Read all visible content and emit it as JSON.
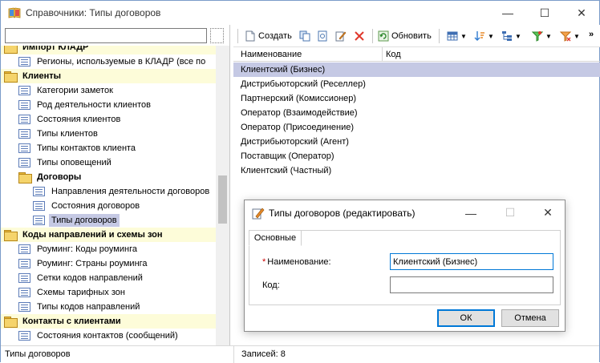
{
  "window": {
    "title": "Справочники: Типы договоров",
    "minimize": "—",
    "maximize": "☐",
    "close": "✕"
  },
  "search": {
    "value": "",
    "placeholder": ""
  },
  "tree": [
    {
      "label": "Импорт КЛАДР",
      "type": "group",
      "indent": 0
    },
    {
      "label": "Регионы, используемые в КЛАДР (все по",
      "type": "item",
      "indent": 1
    },
    {
      "label": "Клиенты",
      "type": "group",
      "indent": 0
    },
    {
      "label": "Категории заметок",
      "type": "item",
      "indent": 1
    },
    {
      "label": "Род деятельности клиентов",
      "type": "item",
      "indent": 1
    },
    {
      "label": "Состояния клиентов",
      "type": "item",
      "indent": 1
    },
    {
      "label": "Типы клиентов",
      "type": "item",
      "indent": 1
    },
    {
      "label": "Типы контактов клиента",
      "type": "item",
      "indent": 1
    },
    {
      "label": "Типы оповещений",
      "type": "item",
      "indent": 1
    },
    {
      "label": "Договоры",
      "type": "subgroup",
      "indent": 1
    },
    {
      "label": "Направления деятельности договоров",
      "type": "item",
      "indent": 2
    },
    {
      "label": "Состояния договоров",
      "type": "item",
      "indent": 2
    },
    {
      "label": "Типы договоров",
      "type": "item",
      "indent": 2,
      "selected": true
    },
    {
      "label": "Коды направлений и схемы зон",
      "type": "group",
      "indent": 0
    },
    {
      "label": "Роуминг: Коды роуминга",
      "type": "item",
      "indent": 1
    },
    {
      "label": "Роуминг: Страны роуминга",
      "type": "item",
      "indent": 1
    },
    {
      "label": "Сетки кодов направлений",
      "type": "item",
      "indent": 1
    },
    {
      "label": "Схемы тарифных зон",
      "type": "item",
      "indent": 1
    },
    {
      "label": "Типы кодов направлений",
      "type": "item",
      "indent": 1
    },
    {
      "label": "Контакты с клиентами",
      "type": "group",
      "indent": 0
    },
    {
      "label": "Состояния контактов (сообщений)",
      "type": "item",
      "indent": 1
    }
  ],
  "toolbar": {
    "create_label": "Создать",
    "refresh_label": "Обновить",
    "more": "»"
  },
  "grid": {
    "columns": [
      "Наименование",
      "Код"
    ],
    "rows": [
      {
        "name": "Клиентский (Бизнес)",
        "code": "",
        "selected": true
      },
      {
        "name": "Дистрибьюторский (Реселлер)",
        "code": ""
      },
      {
        "name": "Партнерский (Комиссионер)",
        "code": ""
      },
      {
        "name": "Оператор (Взаимодействие)",
        "code": ""
      },
      {
        "name": "Оператор (Присоединение)",
        "code": ""
      },
      {
        "name": "Дистрибьюторский (Агент)",
        "code": ""
      },
      {
        "name": "Поставщик (Оператор)",
        "code": ""
      },
      {
        "name": "Клиентский (Частный)",
        "code": ""
      }
    ]
  },
  "status": {
    "left": "Типы договоров",
    "right": "Записей: 8"
  },
  "dialog": {
    "title": "Типы договоров (редактировать)",
    "tab": "Основные",
    "name_label": "Наименование:",
    "required_mark": "*",
    "name_value": "Клиентский (Бизнес)",
    "code_label": "Код:",
    "code_value": "",
    "ok_label": "ОК",
    "cancel_label": "Отмена"
  },
  "colors": {
    "selection": "#c5c9e4",
    "group_bg": "#fdfcd9",
    "accent": "#0078d7",
    "required": "#cc0000"
  }
}
